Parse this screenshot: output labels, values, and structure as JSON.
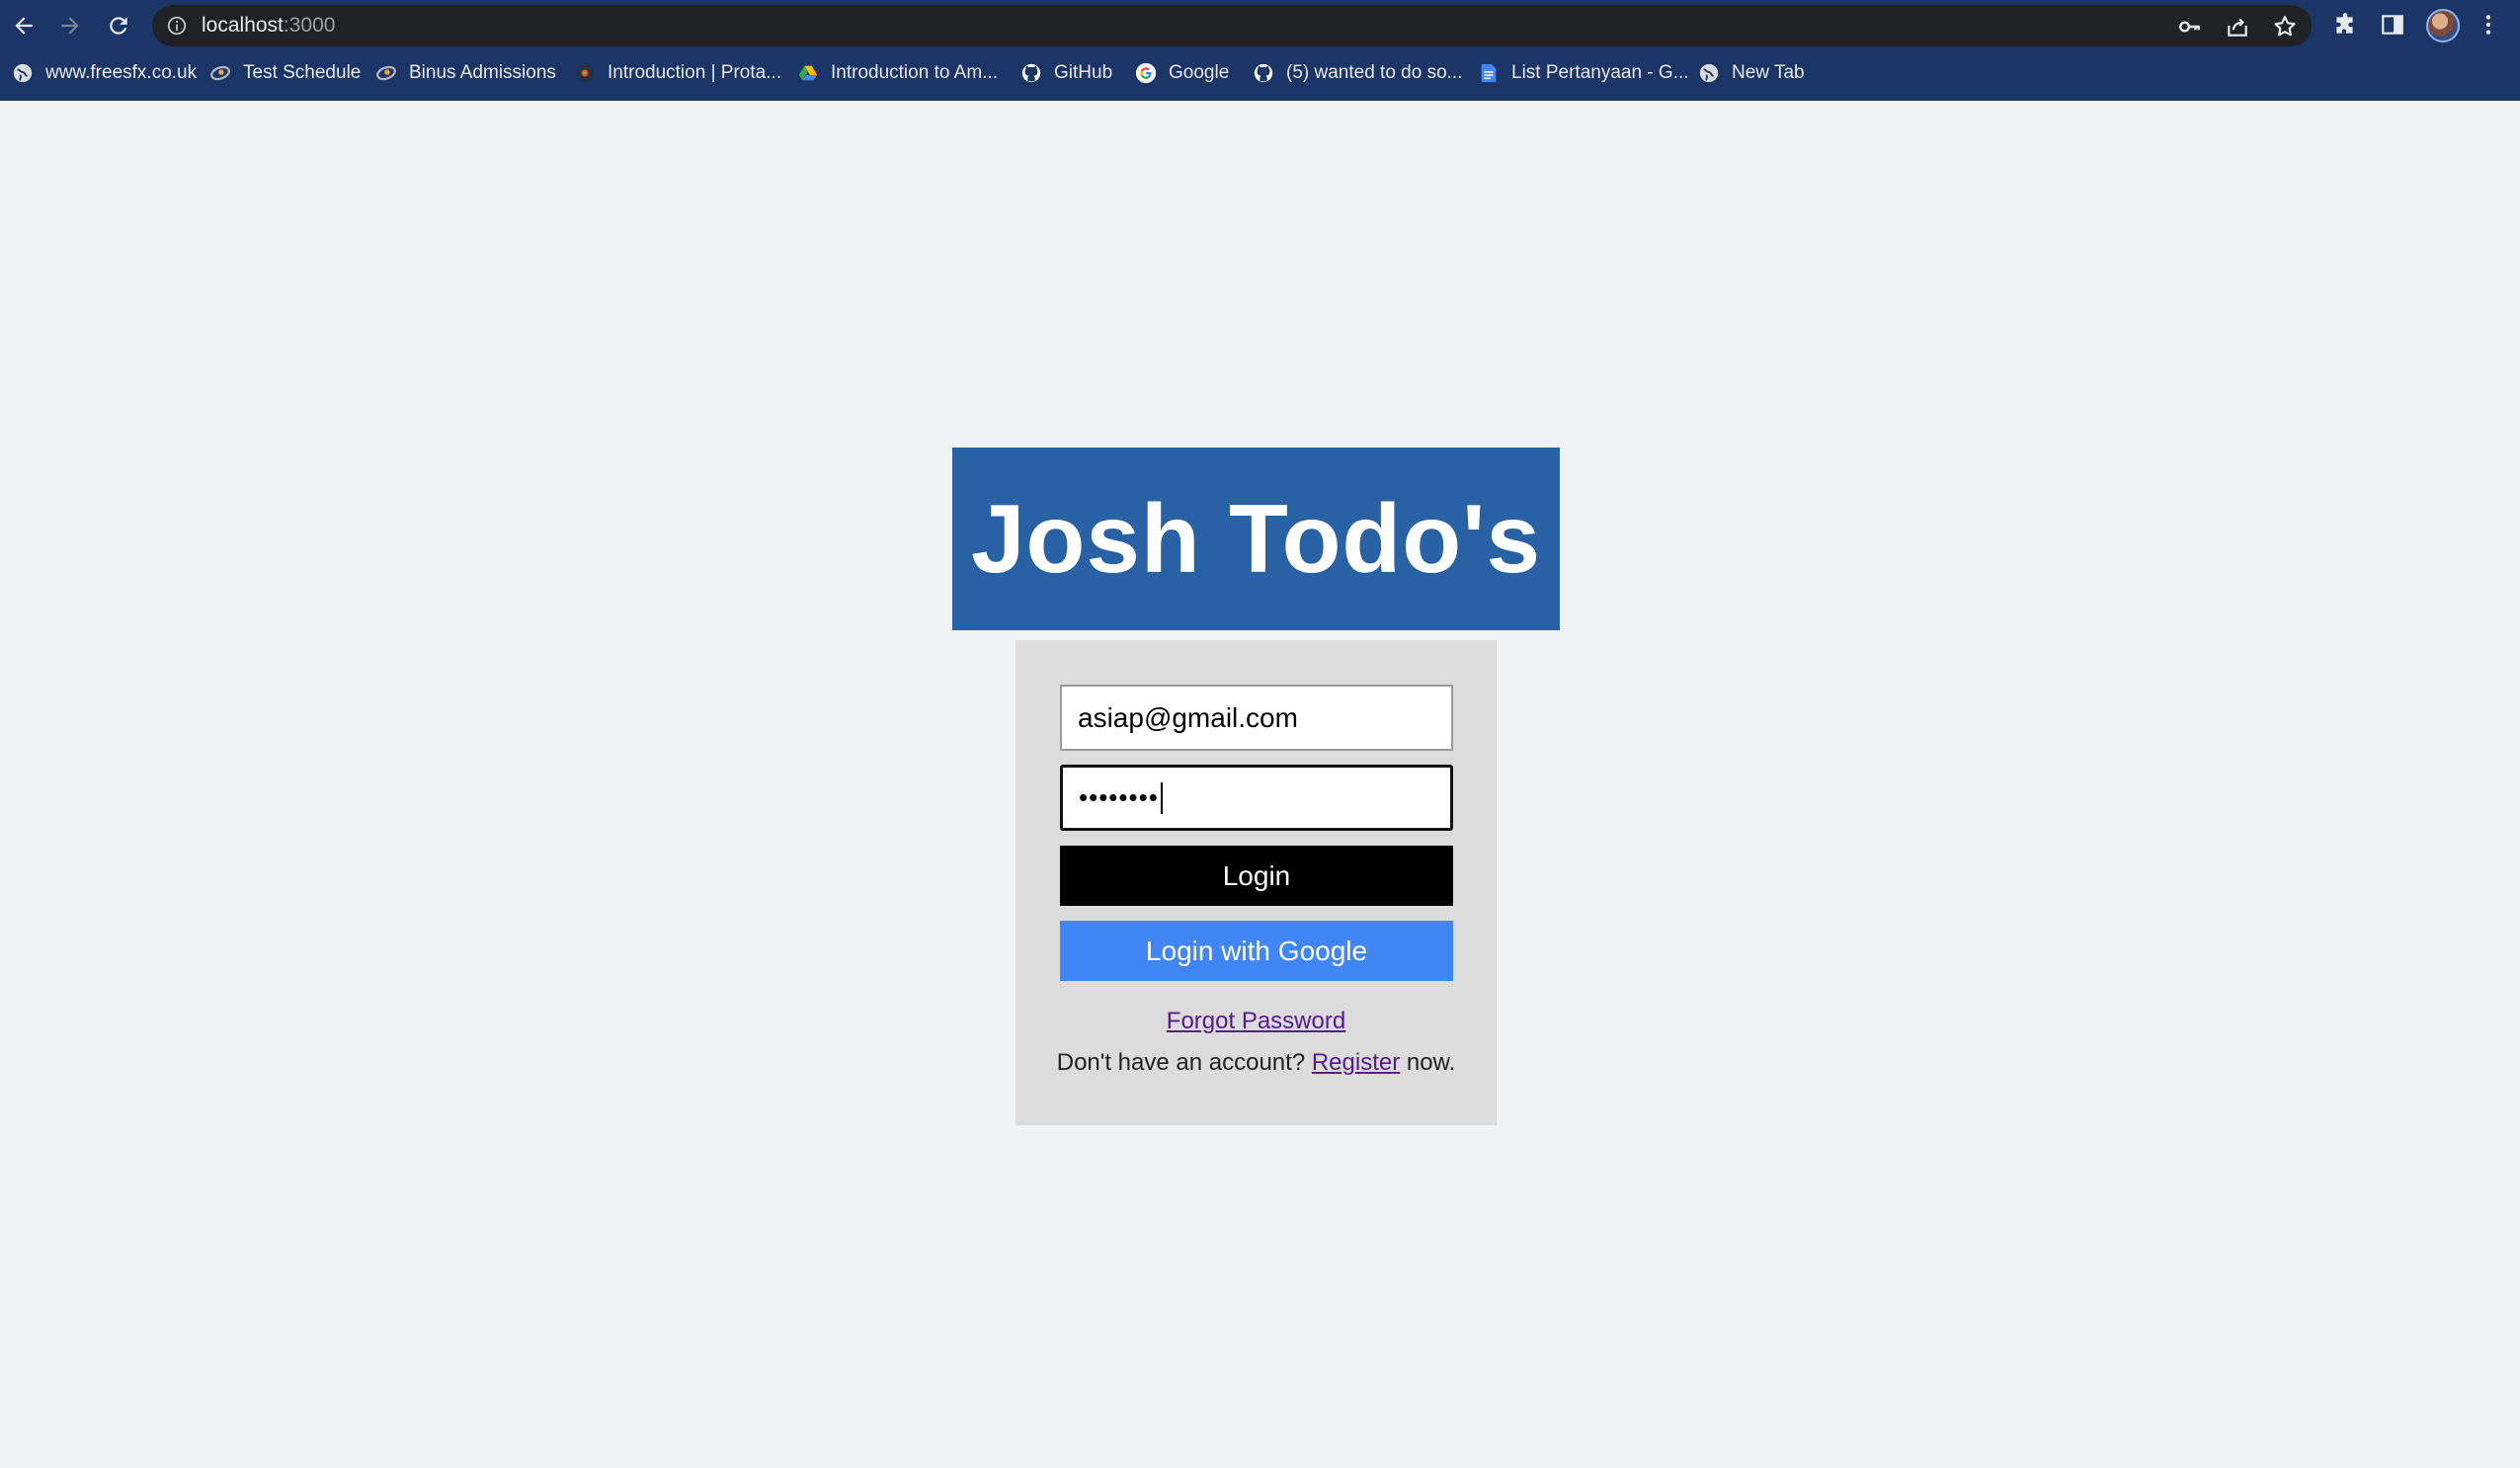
{
  "browser": {
    "url_host": "localhost",
    "url_port": ":3000",
    "bookmarks": [
      {
        "label": "www.freesfx.co.uk",
        "icon": "globe-icon"
      },
      {
        "label": "Test Schedule",
        "icon": "binus-icon"
      },
      {
        "label": "Binus Admissions",
        "icon": "binus-icon"
      },
      {
        "label": "Introduction | Prota...",
        "icon": "protractor-icon"
      },
      {
        "label": "Introduction to Am...",
        "icon": "google-drive-icon"
      },
      {
        "label": "GitHub",
        "icon": "github-icon"
      },
      {
        "label": "Google",
        "icon": "google-icon"
      },
      {
        "label": "(5) wanted to do so...",
        "icon": "github-icon"
      },
      {
        "label": "List Pertanyaan - G...",
        "icon": "google-docs-icon"
      },
      {
        "label": "New Tab",
        "icon": "globe-icon"
      }
    ]
  },
  "app": {
    "title": "Josh Todo's",
    "email_value": "asiap@gmail.com",
    "password_mask": "••••••••",
    "login_label": "Login",
    "google_login_label": "Login with Google",
    "forgot_label": "Forgot Password",
    "register_prefix": "Don't have an account?",
    "register_link": "Register",
    "register_suffix": "now."
  },
  "colors": {
    "chrome_bg": "#1b3566",
    "brand_bg": "#2862a5",
    "card_bg": "#dcdcdc",
    "login_btn": "#000000",
    "google_btn": "#4285f4",
    "link": "#551a8b",
    "page_bg": "#f1f2f4"
  }
}
